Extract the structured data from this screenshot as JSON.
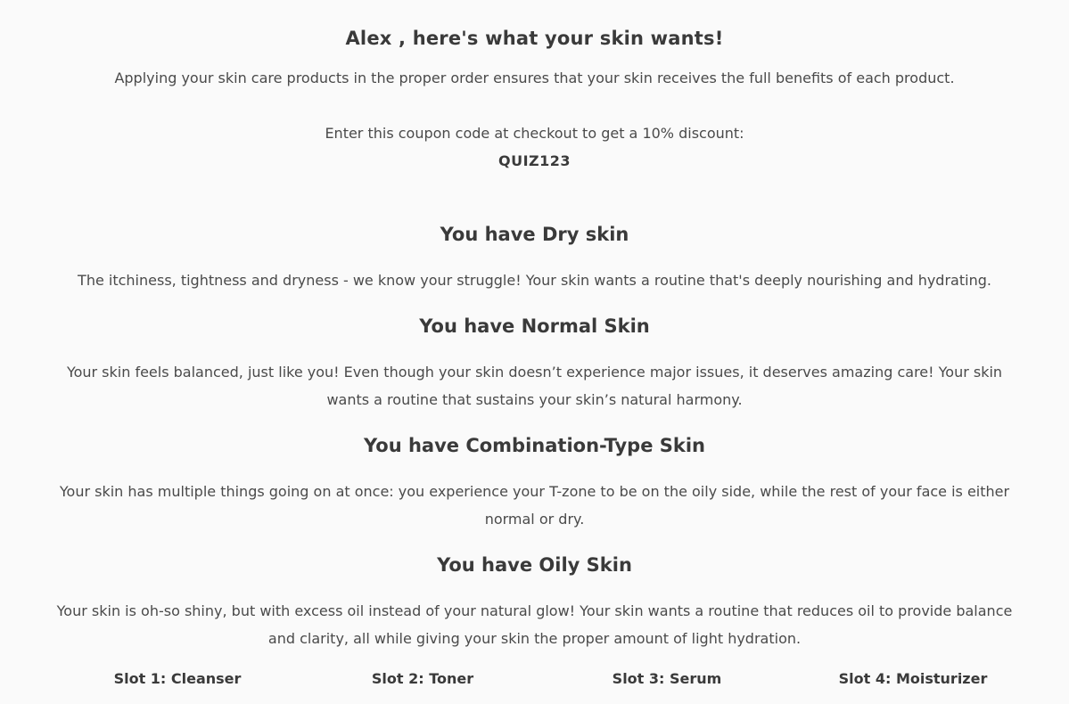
{
  "header": {
    "headline": "Alex , here's what your skin wants!",
    "intro": "Applying your skin care products in the proper order ensures that your skin receives the full benefits of each product."
  },
  "coupon": {
    "label": "Enter this coupon code at checkout to get a 10% discount:",
    "code": "QUIZ123"
  },
  "results": [
    {
      "title": "You have Dry skin",
      "text": "The itchiness, tightness and dryness - we know your struggle! Your skin wants a routine that's deeply nourishing and hydrating."
    },
    {
      "title": "You have Normal Skin",
      "line1": "Your skin feels balanced, just like you! Even though your skin doesn’t experience major issues, it deserves amazing care! Your skin",
      "line2": "wants a routine that sustains your skin’s natural harmony."
    },
    {
      "title": "You have Combination-Type Skin",
      "line1": "Your skin has multiple things going on at once: you experience your T-zone to be on the oily side, while the rest of your face is either",
      "line2": "normal or dry."
    },
    {
      "title": "You have Oily Skin",
      "line1": "Your skin is oh-so shiny, but with excess oil instead of your natural glow! Your skin wants a routine that reduces oil to provide balance",
      "line2": "and clarity, all while giving your skin the proper amount of light hydration."
    }
  ],
  "slots": [
    "Slot 1: Cleanser",
    "Slot 2: Toner",
    "Slot 3: Serum",
    "Slot 4: Moisturizer"
  ]
}
